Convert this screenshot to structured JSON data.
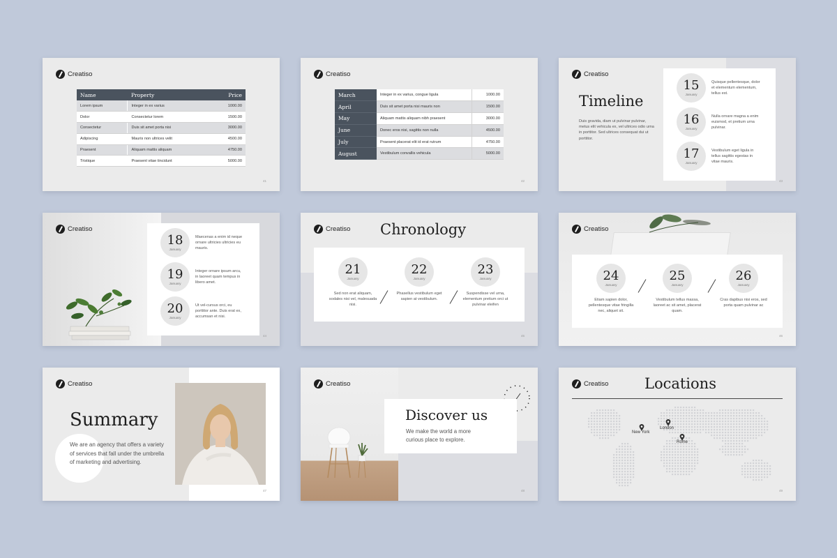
{
  "brand": "Creatiso",
  "slides": {
    "s1": {
      "page": "41",
      "headers": [
        "Name",
        "Property",
        "Price"
      ],
      "rows": [
        [
          "Lorem ipsum",
          "Integer in ex varius",
          "1000.00"
        ],
        [
          "Dolor",
          "Consectetur lorem",
          "1500.00"
        ],
        [
          "Consectetur",
          "Duis sit amet porta nisi",
          "3000.00"
        ],
        [
          "Adipiscing",
          "Mauris non ultrices velit",
          "4500.00"
        ],
        [
          "Praesent",
          "Aliquam mattis aliquam",
          "4750.00"
        ],
        [
          "Tristique",
          "Praesent vitae tincidunt",
          "5000.00"
        ]
      ]
    },
    "s2": {
      "page": "42",
      "rows": [
        [
          "March",
          "Integer in ex varius, congue ligula",
          "1000.00"
        ],
        [
          "April",
          "Duis sit amet porta nisi mauris non",
          "1500.00"
        ],
        [
          "May",
          "Aliquam mattis aliquam nibh praesent",
          "3000.00"
        ],
        [
          "June",
          "Donec eros nisi, sagittis non nulla",
          "4500.00"
        ],
        [
          "July",
          "Praesent placerat elit id erat rutrum",
          "4750.00"
        ],
        [
          "August",
          "Vestibulum convallis vehicula",
          "5000.00"
        ]
      ]
    },
    "s3": {
      "page": "43",
      "title": "Timeline",
      "body": "Duis gravida, diam ut pulvinar pulvinar, metus elit vehicula ex, vel ultrices odio urna in porttitor. Sed ultrices consequat dui ut porttitor.",
      "items": [
        {
          "num": "15",
          "month": "January",
          "text": "Quisque pellentesque, dolor et elementum elementum, tellus est."
        },
        {
          "num": "16",
          "month": "January",
          "text": "Nulla ornare magna a enim euismod, et pretium urna pulvinar."
        },
        {
          "num": "17",
          "month": "January",
          "text": "Vestibulum eget ligula in tellus sagittis egestas in vitae mauris."
        }
      ]
    },
    "s4": {
      "page": "44",
      "items": [
        {
          "num": "18",
          "month": "January",
          "text": "Maecenas a enim id neque ornare ultricies ultricies eu mauris."
        },
        {
          "num": "19",
          "month": "January",
          "text": "Integer ornare ipsum arcu, in laoreet quam tempus in libero amet."
        },
        {
          "num": "20",
          "month": "January",
          "text": "Ut vel-cursus orci, eu porttitor ante. Duis erat ex, accumsan et nisi."
        }
      ]
    },
    "s5": {
      "page": "45",
      "title": "Chronology",
      "items": [
        {
          "num": "21",
          "month": "January",
          "text": "Sed non erat aliquam, sodales nisi vel, malesuada nisi."
        },
        {
          "num": "22",
          "month": "January",
          "text": "Phasellus vestibulum eget sapien at vestibulum."
        },
        {
          "num": "23",
          "month": "January",
          "text": "Suspendisse vel urna, elementum pretium orci ut pulvinar eleifen"
        }
      ]
    },
    "s6": {
      "page": "46",
      "items": [
        {
          "num": "24",
          "month": "January",
          "text": "Etiam sapien dolor, pellentesque vitae fringilla nec, aliquet sit."
        },
        {
          "num": "25",
          "month": "January",
          "text": "Vestibulum tellus massa, laoreet ac sit amet, placerat quam."
        },
        {
          "num": "26",
          "month": "January",
          "text": "Cras dapibus nisi eros, sed porta quam pulvinar ac"
        }
      ]
    },
    "s7": {
      "page": "47",
      "title": "Summary",
      "body": "We are an agency that offers a variety of services that fall under the umbrella of marketing and advertising."
    },
    "s8": {
      "page": "48",
      "title": "Discover us",
      "body": "We make the world a more curious place to explore."
    },
    "s9": {
      "page": "49",
      "title": "Locations",
      "cities": [
        "New York",
        "London",
        "Rome"
      ]
    }
  },
  "colors": {
    "background": "#c0c9da",
    "slide": "#ebebeb",
    "table_header": "#4a535e",
    "circle": "#e6e6e6"
  }
}
